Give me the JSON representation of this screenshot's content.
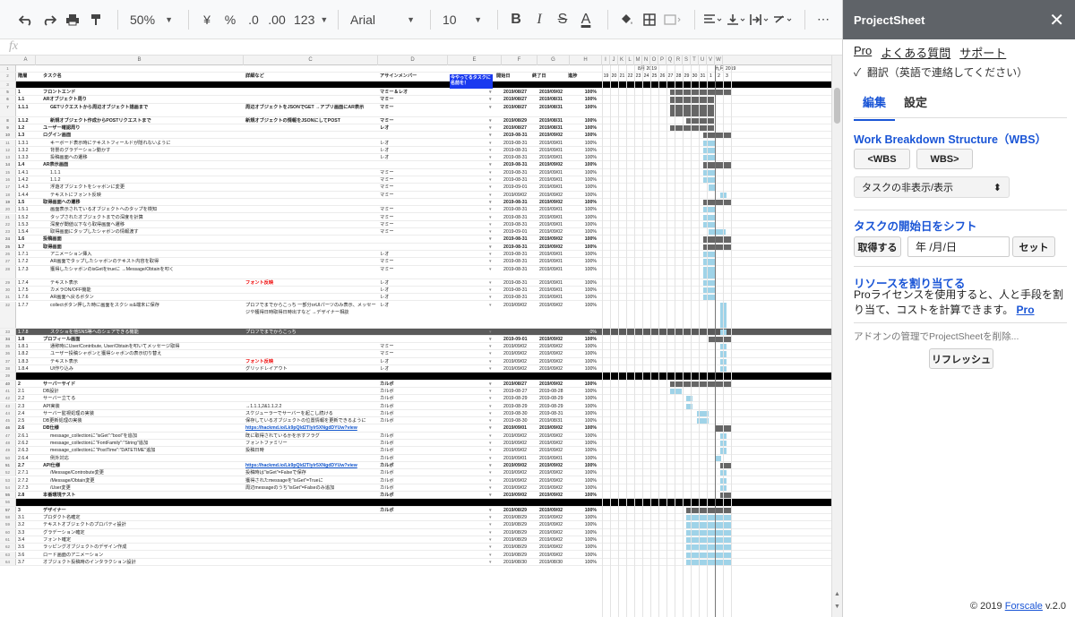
{
  "toolbar": {
    "zoom": "50%",
    "currency": "¥",
    "percent": "%",
    "dec_less": ".0",
    "dec_more": ".00",
    "format": "123",
    "font": "Arial",
    "font_size": "10",
    "bold": "B",
    "italic": "I",
    "strike": "S",
    "text_color": "A",
    "more": "⋯"
  },
  "formula_bar": {
    "icon": "fx"
  },
  "columns": [
    "A",
    "B",
    "C",
    "D",
    "E",
    "F",
    "G",
    "H",
    "I",
    "J",
    "K",
    "L",
    "M",
    "N",
    "O",
    "P",
    "Q",
    "R",
    "S",
    "T",
    "U",
    "V",
    "W"
  ],
  "header_row": {
    "phase": "階層",
    "task": "タスク名",
    "detail": "詳細など",
    "assignee": "アサインメンバー",
    "callout": "今やってるタスクに名前を！",
    "start": "開始日",
    "end": "終了日",
    "progress": "進捗"
  },
  "gantt_header": {
    "month1": "8月 2019",
    "month2": "九月 2019",
    "days": [
      "19",
      "20",
      "21",
      "22",
      "23",
      "24",
      "25",
      "26",
      "27",
      "28",
      "29",
      "30",
      "31",
      "1",
      "2",
      "3"
    ]
  },
  "rows": [
    {
      "n": "5",
      "id": "1",
      "task": "フロントエンド",
      "detail": "",
      "who": "マミー＆レオ",
      "s": "2019/08/27",
      "e": "2019/09/02",
      "p": "100%",
      "cls": "sec",
      "g": [
        [
          76,
          49,
          "dark"
        ],
        [
          125,
          19,
          "dark"
        ]
      ]
    },
    {
      "n": "6",
      "id": "1.1",
      "task": "ARオブジェクト周り",
      "detail": "",
      "who": "マミー",
      "s": "2019/08/27",
      "e": "2019/08/31",
      "p": "100%",
      "cls": "sec",
      "g": [
        [
          76,
          49,
          "dark"
        ]
      ]
    },
    {
      "n": "7",
      "id": "1.1.1",
      "task": "GETリクエストから周辺オブジェクト描画まで",
      "detail": "周辺オブジェクトをJSONでGET →アプリ画面にAR表示",
      "who": "マミー",
      "s": "2019/08/27",
      "e": "2019/08/31",
      "p": "100%",
      "cls": "sec",
      "g": [
        [
          76,
          49,
          "dark"
        ]
      ],
      "h": 15
    },
    {
      "n": "8",
      "id": "1.1.2",
      "task": "新規オブジェクト作成からPOSTリクエストまで",
      "detail": "新規オブジェクトの情報をJSONにしてPOST",
      "who": "マミー",
      "s": "2019/08/29",
      "e": "2019/08/31",
      "p": "100%",
      "cls": "sec",
      "g": [
        [
          94,
          31,
          "dark"
        ]
      ]
    },
    {
      "n": "9",
      "id": "1.2",
      "task": "ユーザー確認周り",
      "detail": "",
      "who": "レオ",
      "s": "2019/08/27",
      "e": "2019/08/31",
      "p": "100%",
      "cls": "sec",
      "g": [
        [
          76,
          49,
          "dark"
        ]
      ]
    },
    {
      "n": "10",
      "id": "1.3",
      "task": "ログイン画面",
      "detail": "",
      "who": "",
      "s": "2019-08-31",
      "e": "2019/09/02",
      "p": "100%",
      "cls": "sec",
      "g": [
        [
          113,
          31,
          "dark"
        ]
      ]
    },
    {
      "n": "11",
      "id": "1.3.1",
      "task": "キーボード表示時にテキストフィールドが隠れないように",
      "detail": "",
      "who": "レオ",
      "s": "2019-08-31",
      "e": "2019/09/01",
      "p": "100%",
      "cls": "",
      "g": [
        [
          113,
          13,
          "blue"
        ]
      ]
    },
    {
      "n": "12",
      "id": "1.3.2",
      "task": "背景のグラデーション動かす",
      "detail": "",
      "who": "レオ",
      "s": "2019-08-31",
      "e": "2019/09/01",
      "p": "100%",
      "cls": "",
      "g": [
        [
          113,
          13,
          "blue"
        ]
      ]
    },
    {
      "n": "13",
      "id": "1.3.3",
      "task": "投稿画面への遷移",
      "detail": "",
      "who": "レオ",
      "s": "2019-08-31",
      "e": "2019/09/01",
      "p": "100%",
      "cls": "",
      "g": [
        [
          113,
          13,
          "blue"
        ]
      ]
    },
    {
      "n": "14",
      "id": "1.4",
      "task": "AR表示画面",
      "detail": "",
      "who": "",
      "s": "2019-08-31",
      "e": "2019/09/02",
      "p": "100%",
      "cls": "sec",
      "g": [
        [
          113,
          31,
          "dark"
        ]
      ]
    },
    {
      "n": "15",
      "id": "1.4.1",
      "task": "1.1.1",
      "detail": "",
      "who": "マミー",
      "s": "2019-08-31",
      "e": "2019/09/01",
      "p": "100%",
      "cls": "",
      "g": [
        [
          113,
          13,
          "blue"
        ]
      ]
    },
    {
      "n": "16",
      "id": "1.4.2",
      "task": "1.1.2",
      "detail": "",
      "who": "マミー",
      "s": "2019-08-31",
      "e": "2019/09/01",
      "p": "100%",
      "cls": "",
      "g": [
        [
          113,
          13,
          "blue"
        ]
      ]
    },
    {
      "n": "17",
      "id": "1.4.3",
      "task": "浮遊オブジェクトをシャボンに変更",
      "detail": "",
      "who": "マミー",
      "s": "2019-09-01",
      "e": "2019/09/01",
      "p": "100%",
      "cls": "",
      "g": [
        [
          119,
          7,
          "blue"
        ]
      ]
    },
    {
      "n": "18",
      "id": "1.4.4",
      "task": "テキストにフォント反映",
      "detail": "",
      "who": "マミー",
      "s": "2019/09/02",
      "e": "2019/09/02",
      "p": "100%",
      "cls": "",
      "g": [
        [
          132,
          7,
          "blue"
        ]
      ]
    },
    {
      "n": "19",
      "id": "1.5",
      "task": "取得画面への遷移",
      "detail": "",
      "who": "",
      "s": "2019-08-31",
      "e": "2019/09/02",
      "p": "100%",
      "cls": "sec",
      "g": [
        [
          113,
          31,
          "dark"
        ]
      ]
    },
    {
      "n": "20",
      "id": "1.5.1",
      "task": "画面表示されているオブジェクトへのタップを検知",
      "detail": "",
      "who": "マミー",
      "s": "2019-08-31",
      "e": "2019/09/01",
      "p": "100%",
      "cls": "",
      "g": [
        [
          113,
          13,
          "blue"
        ]
      ]
    },
    {
      "n": "21",
      "id": "1.5.2",
      "task": "タップされたオブジェクトまでの深度を計算",
      "detail": "",
      "who": "マミー",
      "s": "2019-08-31",
      "e": "2019/09/01",
      "p": "100%",
      "cls": "",
      "g": [
        [
          113,
          13,
          "blue"
        ]
      ]
    },
    {
      "n": "22",
      "id": "1.5.3",
      "task": "深度が閾値以下なら取得画面へ遷移",
      "detail": "",
      "who": "マミー",
      "s": "2019-08-31",
      "e": "2019/09/01",
      "p": "100%",
      "cls": "",
      "g": [
        [
          113,
          13,
          "blue"
        ]
      ]
    },
    {
      "n": "23",
      "id": "1.5.4",
      "task": "取得画面にタップしたシャボンの情報渡す",
      "detail": "",
      "who": "マミー",
      "s": "2019-09-01",
      "e": "2019/09/02",
      "p": "100%",
      "cls": "",
      "g": [
        [
          119,
          19,
          "blue"
        ]
      ]
    },
    {
      "n": "24",
      "id": "1.6",
      "task": "投稿画面",
      "detail": "",
      "who": "",
      "s": "2019-08-31",
      "e": "2019/09/02",
      "p": "100%",
      "cls": "sec",
      "g": [
        [
          113,
          31,
          "dark"
        ]
      ]
    },
    {
      "n": "25",
      "id": "1.7",
      "task": "取得画面",
      "detail": "",
      "who": "",
      "s": "2019-08-31",
      "e": "2019/09/02",
      "p": "100%",
      "cls": "sec",
      "g": [
        [
          113,
          31,
          "dark"
        ]
      ]
    },
    {
      "n": "26",
      "id": "1.7.1",
      "task": "アニメーション挿入",
      "detail": "",
      "who": "レオ",
      "s": "2019-08-31",
      "e": "2019/09/01",
      "p": "100%",
      "cls": "",
      "g": [
        [
          113,
          13,
          "blue"
        ]
      ]
    },
    {
      "n": "27",
      "id": "1.7.2",
      "task": "AR画面でタップしたシャボンのテキスト内容を取得",
      "detail": "",
      "who": "マミー",
      "s": "2019-08-31",
      "e": "2019/09/01",
      "p": "100%",
      "cls": "",
      "g": [
        [
          113,
          13,
          "blue"
        ]
      ]
    },
    {
      "n": "28",
      "id": "1.7.3",
      "task": "獲得したシャボンのisGetをtrueに →Message/Obtainを叩く",
      "detail": "",
      "who": "マミー",
      "s": "2019-08-31",
      "e": "2019/09/01",
      "p": "100%",
      "cls": "",
      "g": [
        [
          113,
          13,
          "blue"
        ]
      ],
      "h": 15
    },
    {
      "n": "29",
      "id": "1.7.4",
      "task": "テキスト表示",
      "detail": "フォント反映",
      "detailCls": "red",
      "who": "レオ",
      "s": "2019-08-31",
      "e": "2019/09/01",
      "p": "100%",
      "cls": "",
      "g": [
        [
          113,
          13,
          "blue"
        ]
      ]
    },
    {
      "n": "30",
      "id": "1.7.5",
      "task": "カメラON/OFF機能",
      "detail": "",
      "who": "レオ",
      "s": "2019-08-31",
      "e": "2019/09/01",
      "p": "100%",
      "cls": "",
      "g": [
        [
          113,
          13,
          "blue"
        ]
      ]
    },
    {
      "n": "31",
      "id": "1.7.6",
      "task": "AR画面へ戻るボタン",
      "detail": "",
      "who": "レオ",
      "s": "2019-08-31",
      "e": "2019/09/01",
      "p": "100%",
      "cls": "",
      "g": [
        [
          113,
          13,
          "blue"
        ]
      ]
    },
    {
      "n": "32",
      "id": "1.7.7",
      "task": "collectボタン押した時に画面をスクショ&端末に保存",
      "detail": "プロフでまでからこっち 一部分orUIパーツのみ表示、メッセージや獲得日時取得日時出すなど →デザイナー相談",
      "who": "レオ",
      "s": "2019/09/02",
      "e": "2019/09/02",
      "p": "100%",
      "cls": "",
      "g": [
        [
          132,
          7,
          "blue"
        ]
      ],
      "h": 30
    },
    {
      "n": "33",
      "id": "1.7.8",
      "task": "スクショを他SNS等へのシェアできる機能",
      "detail": "プロフでまでからこっち",
      "who": "",
      "s": "",
      "e": "",
      "p": "0%",
      "cls": "hl",
      "g": [
        [
          132,
          7,
          "blue"
        ]
      ]
    },
    {
      "n": "34",
      "id": "1.8",
      "task": "プロフィール画面",
      "detail": "",
      "who": "",
      "s": "2019-09-01",
      "e": "2019/09/02",
      "p": "100%",
      "cls": "sec",
      "g": [
        [
          119,
          25,
          "dark"
        ]
      ]
    },
    {
      "n": "35",
      "id": "1.8.1",
      "task": "通称時にUser/Contribute, User/Obtainを叩いてメッセージ取得",
      "detail": "",
      "who": "マミー",
      "s": "2019/09/02",
      "e": "2019/09/02",
      "p": "100%",
      "cls": "",
      "g": [
        [
          132,
          7,
          "blue"
        ]
      ]
    },
    {
      "n": "36",
      "id": "1.8.2",
      "task": "ユーザー投稿シャボンと獲得シャボンの表示切り替え",
      "detail": "",
      "who": "マミー",
      "s": "2019/09/02",
      "e": "2019/09/02",
      "p": "100%",
      "cls": "",
      "g": [
        [
          132,
          7,
          "blue"
        ]
      ]
    },
    {
      "n": "37",
      "id": "1.8.3",
      "task": "テキスト表示",
      "detail": "フォント反映",
      "detailCls": "red",
      "who": "レオ",
      "s": "2019/09/02",
      "e": "2019/09/02",
      "p": "100%",
      "cls": "",
      "g": [
        [
          132,
          7,
          "blue"
        ]
      ]
    },
    {
      "n": "38",
      "id": "1.8.4",
      "task": "UI作り込み",
      "detail": "グリッドレイアウト",
      "who": "レオ",
      "s": "2019/09/02",
      "e": "2019/09/02",
      "p": "100%",
      "cls": "",
      "g": [
        [
          132,
          7,
          "blue"
        ]
      ]
    },
    {
      "n": "39",
      "id": "",
      "task": "",
      "detail": "",
      "who": "",
      "s": "",
      "e": "",
      "p": "",
      "cls": "black",
      "g": []
    },
    {
      "n": "40",
      "id": "2",
      "task": "サーバーサイド",
      "detail": "",
      "who": "カルボ",
      "s": "2019/08/27",
      "e": "2019/09/02",
      "p": "100%",
      "cls": "sec",
      "g": [
        [
          76,
          68,
          "dark"
        ]
      ]
    },
    {
      "n": "41",
      "id": "2.1",
      "task": "DB設計",
      "detail": "",
      "who": "カルボ",
      "s": "2019-08-27",
      "e": "2019-08-28",
      "p": "100%",
      "cls": "",
      "g": [
        [
          76,
          13,
          "blue"
        ]
      ]
    },
    {
      "n": "42",
      "id": "2.2",
      "task": "サーバー立てる",
      "detail": "",
      "who": "カルボ",
      "s": "2019-08-29",
      "e": "2019-08-29",
      "p": "100%",
      "cls": "",
      "g": [
        [
          94,
          7,
          "blue"
        ]
      ]
    },
    {
      "n": "43",
      "id": "2.3",
      "task": "API実装",
      "detail": "→1.1.1,2&1.1.2.2",
      "who": "カルボ",
      "s": "2019-08-29",
      "e": "2019-08-29",
      "p": "100%",
      "cls": "",
      "g": [
        [
          94,
          7,
          "blue"
        ]
      ]
    },
    {
      "n": "44",
      "id": "2.4",
      "task": "サーバー監視処理の実装",
      "detail": "スケジューラーでサーバーを起こし続ける",
      "who": "カルボ",
      "s": "2019-08-30",
      "e": "2019-08-31",
      "p": "100%",
      "cls": "",
      "g": [
        [
          106,
          13,
          "blue"
        ]
      ]
    },
    {
      "n": "45",
      "id": "2.5",
      "task": "DB更新処理の実装",
      "detail": "保存しているオブジェクトの位置情報を更新できるように",
      "who": "カルボ",
      "s": "2019-08-30",
      "e": "2019/08/31",
      "p": "100%",
      "cls": "",
      "g": [
        [
          106,
          13,
          "blue"
        ]
      ]
    },
    {
      "n": "46",
      "id": "2.6",
      "task": "DB仕様",
      "detail": "https://hackmd.io/Lk9pQId2TIylr5XNgdDYUw?view",
      "detailCls": "link",
      "who": "",
      "s": "2019/09/01",
      "e": "2019/09/02",
      "p": "100%",
      "cls": "sec",
      "g": [
        [
          126,
          18,
          "dark"
        ]
      ]
    },
    {
      "n": "47",
      "id": "2.6.1",
      "task": "message_collectionに\"isGet\":\"bool\"を追加",
      "detail": "既に取得されているかを示すフラグ",
      "who": "カルボ",
      "s": "2019/09/02",
      "e": "2019/09/02",
      "p": "100%",
      "cls": "",
      "g": [
        [
          132,
          7,
          "blue"
        ]
      ]
    },
    {
      "n": "48",
      "id": "2.6.2",
      "task": "message_collectionに\"FontFamily\":\"String\"追加",
      "detail": "フォントファミリー",
      "who": "カルボ",
      "s": "2019/09/02",
      "e": "2019/09/02",
      "p": "100%",
      "cls": "",
      "g": [
        [
          132,
          7,
          "blue"
        ]
      ]
    },
    {
      "n": "49",
      "id": "2.6.3",
      "task": "message_collectionに\"PostTime\":\"DATETIME\"追加",
      "detail": "投稿日時",
      "who": "カルボ",
      "s": "2019/09/02",
      "e": "2019/09/02",
      "p": "100%",
      "cls": "",
      "g": [
        [
          132,
          7,
          "blue"
        ]
      ]
    },
    {
      "n": "50",
      "id": "2.6.4",
      "task": "例外対応",
      "detail": "",
      "who": "カルボ",
      "s": "2019/09/01",
      "e": "2019/09/01",
      "p": "100%",
      "cls": "",
      "g": [
        [
          126,
          7,
          "blue"
        ]
      ]
    },
    {
      "n": "51",
      "id": "2.7",
      "task": "API仕様",
      "detail": "https://hackmd.io/Lk9pQId2TIylr5XNgdDYUw?view",
      "detailCls": "link",
      "who": "カルボ",
      "s": "2019/09/02",
      "e": "2019/09/02",
      "p": "100%",
      "cls": "sec",
      "g": [
        [
          132,
          12,
          "dark"
        ]
      ]
    },
    {
      "n": "52",
      "id": "2.7.1",
      "task": "/Message/Controbute変更",
      "detail": "投稿時は\"isGet\"=Falseで保存",
      "who": "カルボ",
      "s": "2019/09/02",
      "e": "2019/09/02",
      "p": "100%",
      "cls": "",
      "g": [
        [
          132,
          7,
          "blue"
        ]
      ]
    },
    {
      "n": "53",
      "id": "2.7.2",
      "task": "/Message/Obtain変更",
      "detail": "獲得されたmessageを\"isGet\"=Trueに",
      "who": "カルボ",
      "s": "2019/09/02",
      "e": "2019/09/02",
      "p": "100%",
      "cls": "",
      "g": [
        [
          132,
          7,
          "blue"
        ]
      ]
    },
    {
      "n": "54",
      "id": "2.7.3",
      "task": "/User変更",
      "detail": "周辺messageのうち\"isGet\"=Falseのみ追加",
      "who": "カルボ",
      "s": "2019/09/02",
      "e": "2019/09/02",
      "p": "100%",
      "cls": "",
      "g": [
        [
          132,
          7,
          "blue"
        ]
      ]
    },
    {
      "n": "55",
      "id": "2.8",
      "task": "本番環境テスト",
      "detail": "",
      "who": "カルボ",
      "s": "2019/09/02",
      "e": "2019/09/02",
      "p": "100%",
      "cls": "sec",
      "g": [
        [
          132,
          12,
          "dark"
        ]
      ]
    },
    {
      "n": "56",
      "id": "",
      "task": "",
      "detail": "",
      "who": "",
      "s": "",
      "e": "",
      "p": "",
      "cls": "black",
      "g": []
    },
    {
      "n": "57",
      "id": "3",
      "task": "デザイナー",
      "detail": "",
      "who": "カルボ",
      "s": "2019/08/29",
      "e": "2019/09/02",
      "p": "100%",
      "cls": "sec",
      "g": [
        [
          94,
          50,
          "dark"
        ]
      ]
    },
    {
      "n": "58",
      "id": "3.1",
      "task": "プロダクト名確定",
      "detail": "",
      "who": "",
      "s": "2019/08/29",
      "e": "2019/09/02",
      "p": "100%",
      "cls": "",
      "g": [
        [
          94,
          50,
          "blue"
        ]
      ]
    },
    {
      "n": "59",
      "id": "3.2",
      "task": "テキストオブジェクトのプロパティ設計",
      "detail": "",
      "who": "",
      "s": "2019/08/29",
      "e": "2019/09/02",
      "p": "100%",
      "cls": "",
      "g": [
        [
          94,
          50,
          "blue"
        ]
      ]
    },
    {
      "n": "60",
      "id": "3.3",
      "task": "グラデーション確定",
      "detail": "",
      "who": "",
      "s": "2019/08/29",
      "e": "2019/09/02",
      "p": "100%",
      "cls": "",
      "g": [
        [
          94,
          50,
          "blue"
        ]
      ]
    },
    {
      "n": "61",
      "id": "3.4",
      "task": "フォント確定",
      "detail": "",
      "who": "",
      "s": "2019/08/29",
      "e": "2019/09/02",
      "p": "100%",
      "cls": "",
      "g": [
        [
          94,
          50,
          "blue"
        ]
      ]
    },
    {
      "n": "62",
      "id": "3.5",
      "task": "ラッピングオブジェクトのデザイン作成",
      "detail": "",
      "who": "",
      "s": "2019/08/29",
      "e": "2019/09/02",
      "p": "100%",
      "cls": "",
      "g": [
        [
          94,
          50,
          "blue"
        ]
      ]
    },
    {
      "n": "63",
      "id": "3.6",
      "task": "ロード画面のアニメーション",
      "detail": "",
      "who": "",
      "s": "2019/08/29",
      "e": "2019/09/02",
      "p": "100%",
      "cls": "",
      "g": [
        [
          94,
          50,
          "blue"
        ]
      ]
    },
    {
      "n": "64",
      "id": "3.7",
      "task": "オブジェクト投稿時のインタラクション設計",
      "detail": "",
      "who": "",
      "s": "2019/08/30",
      "e": "2019/08/30",
      "p": "100%",
      "cls": "",
      "g": [
        [
          94,
          50,
          "blue"
        ]
      ]
    }
  ],
  "panel": {
    "title": "ProjectSheet",
    "close": "✕",
    "links": [
      "Pro",
      "よくある質問",
      "サポート"
    ],
    "translate_label": "翻訳（英語で連絡してください）",
    "tabs": [
      "編集",
      "設定"
    ],
    "wbs_heading": "Work Breakdown Structure（WBS）",
    "wbs_prev": "<WBS",
    "wbs_next": "WBS>",
    "task_toggle": "タスクの非表示/表示",
    "shift_heading": "タスクの開始日をシフト",
    "get_button": "取得する",
    "date_placeholder": "年 /月/日",
    "set_button": "セット",
    "resource_heading": "リソースを割り当てる",
    "resource_text": "Proライセンスを使用すると、人と手段を割り当て、コストを計算できます。",
    "resource_link": "Pro",
    "remove_text": "アドオンの管理でProjectSheetを削除...",
    "refresh_button": "リフレッシュ",
    "copyright": "© 2019",
    "copyright_brand": "Forscale",
    "version": "v.2.0"
  }
}
